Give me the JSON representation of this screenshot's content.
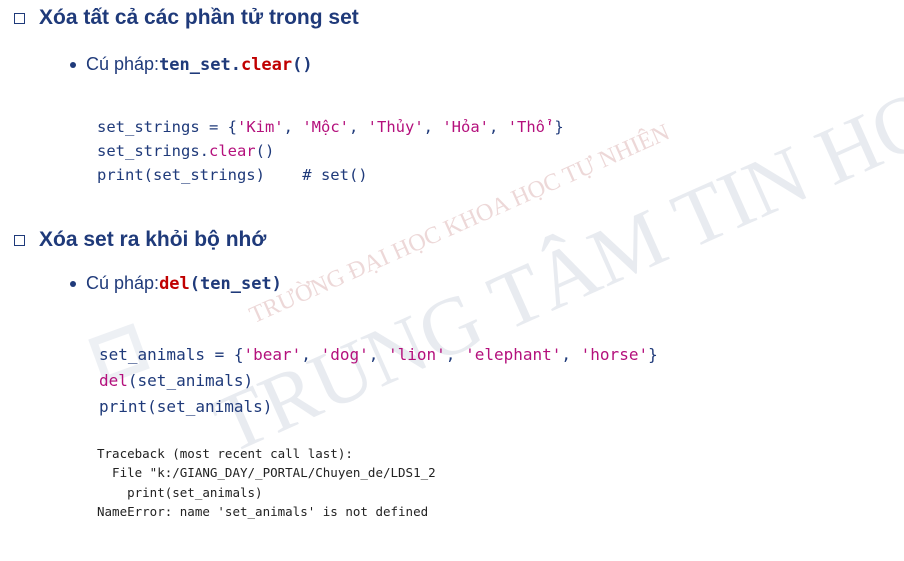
{
  "section1": {
    "heading": "Xóa tất cả các phần tử trong set",
    "syntax_label": "Cú pháp: ",
    "syntax_prefix": "ten_set.",
    "syntax_method": "clear",
    "syntax_suffix": "()",
    "code": {
      "line1_a": "set_strings = {",
      "line1_s1": "'Kim'",
      "line1_c1": ", ",
      "line1_s2": "'Mộc'",
      "line1_c2": ", ",
      "line1_s3": "'Thủy'",
      "line1_c3": ", ",
      "line1_s4": "'Hỏa'",
      "line1_c4": ", ",
      "line1_s5": "'Thổ'",
      "line1_end": "}",
      "line2_a": "set_strings.",
      "line2_fn": "clear",
      "line2_end": "()",
      "line3_a": "print(set_strings)    # set()"
    }
  },
  "section2": {
    "heading": "Xóa set ra khỏi bộ nhớ",
    "syntax_label": "Cú pháp: ",
    "syntax_kw": "del",
    "syntax_rest": "(ten_set)",
    "code": {
      "line1_a": "set_animals = {",
      "line1_s1": "'bear'",
      "line1_c1": ", ",
      "line1_s2": "'dog'",
      "line1_c2": ", ",
      "line1_s3": "'lion'",
      "line1_c3": ", ",
      "line1_s4": "'elephant'",
      "line1_c4": ", ",
      "line1_s5": "'horse'",
      "line1_end": "}",
      "line2_kw": "del",
      "line2_rest": "(set_animals)",
      "line3": "print(set_animals)"
    },
    "traceback": [
      "Traceback (most recent call last):",
      "  File \"k:/GIANG_DAY/_PORTAL/Chuyen_de/LDS1_2",
      "    print(set_animals)",
      "NameError: name 'set_animals' is not defined"
    ]
  },
  "watermark": {
    "big_text": "TRUNG TÂM TIN HỌC",
    "small_text": "TRƯỜNG ĐẠI HỌC KHOA HỌC TỰ NHIÊN"
  }
}
